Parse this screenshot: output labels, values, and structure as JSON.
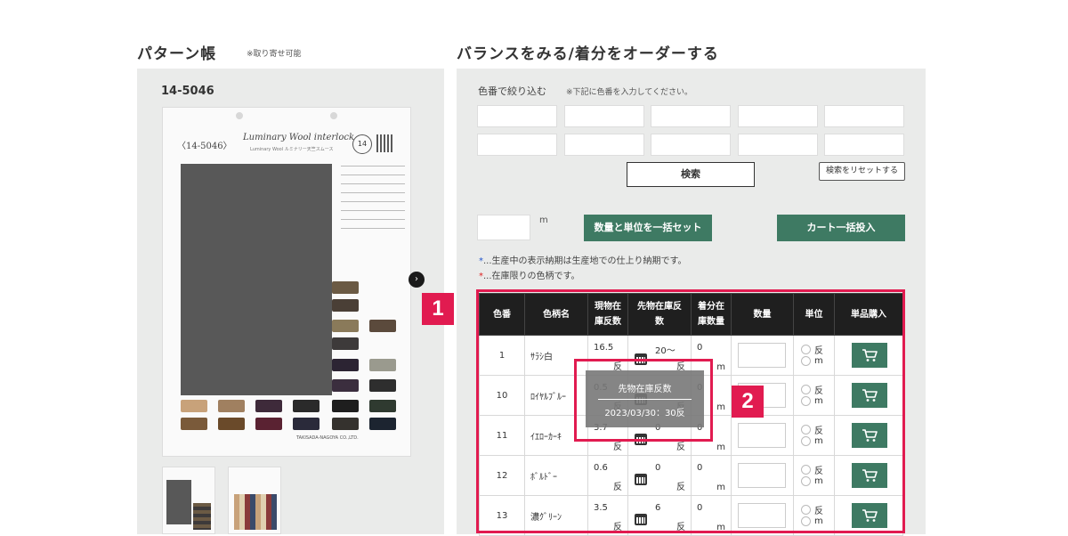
{
  "left": {
    "heading": "パターン帳",
    "heading_note": "※取り寄せ可能",
    "pattern_code": "14-5046",
    "card": {
      "code": "〈14-5046〉",
      "title": "Luminary Wool interlock",
      "subtitle": "Luminary Wool ルミナリー天竺スムース",
      "logo_text": "14",
      "footer": "TAKISADA-NAGOYA CO.,LTD."
    }
  },
  "right": {
    "heading": "バランスをみる/着分をオーダーする",
    "filter_label": "色番で絞り込む",
    "filter_note": "※下記に色番を入力してください。",
    "search_label": "検索",
    "reset_label": "検索をリセットする",
    "qty_unit": "m",
    "bulk_set_label": "数量と単位を一括セット",
    "cart_bulk_label": "カート一括投入",
    "note1_mark": "*",
    "note1_text": "...生産中の表示納期は生産地での仕上り納期です。",
    "note2_mark": "*",
    "note2_text": "...在庫限りの色柄です。"
  },
  "table": {
    "headers": [
      "色番",
      "色柄名",
      "現物在\n庫反数",
      "先物在庫反\n数",
      "着分在\n庫数量",
      "数量",
      "単位",
      "単品購入"
    ],
    "unit_tan": "反",
    "unit_m": "m",
    "rows": [
      {
        "no": "1",
        "name": "ｻﾗｼ白",
        "stock": "16.5",
        "future": "20〜",
        "cut": "0"
      },
      {
        "no": "10",
        "name": "ﾛｲﾔﾙﾌﾞﾙｰ",
        "stock": "0.5",
        "future": "",
        "cut": "0"
      },
      {
        "no": "11",
        "name": "ｲｴﾛｰｶｰｷ",
        "stock": "3.7",
        "future": "0",
        "cut": "0"
      },
      {
        "no": "12",
        "name": "ﾎﾞﾙﾄﾞｰ",
        "stock": "0.6",
        "future": "0",
        "cut": "0"
      },
      {
        "no": "13",
        "name": "濃ｸﾞﾘｰﾝ",
        "stock": "3.5",
        "future": "6",
        "cut": "0"
      }
    ]
  },
  "tooltip": {
    "title": "先物在庫反数",
    "body": "2023/03/30：30反"
  },
  "annotations": {
    "badge1": "1",
    "badge2": "2",
    "accent_color": "#e11b50"
  },
  "colors": {
    "button_green": "#3e7a63",
    "panel_gray": "#eaebea",
    "header_black": "#1f1f1f"
  }
}
